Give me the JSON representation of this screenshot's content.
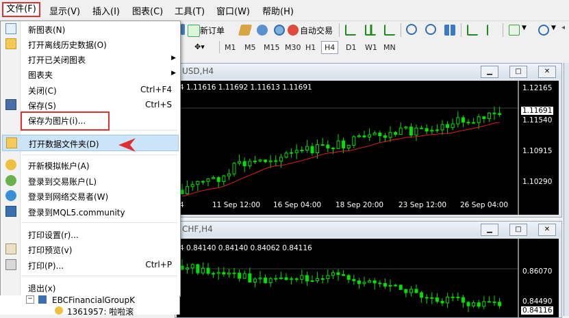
{
  "menubar": {
    "items": [
      "文件(F)",
      "显示(V)",
      "插入(I)",
      "图表(C)",
      "工具(T)",
      "窗口(W)",
      "帮助(H)"
    ]
  },
  "toolbar": {
    "new_order": "新订单",
    "auto_trading": "自动交易",
    "timeframes": [
      "M1",
      "M5",
      "M15",
      "M30",
      "H1",
      "H4",
      "D1",
      "W1",
      "MN"
    ],
    "active_timeframe": "H4"
  },
  "file_menu": {
    "items": [
      {
        "label": "新图表(N)",
        "shortcut": "",
        "submenu": false,
        "icon": "new-chart-icon"
      },
      {
        "label": "打开离线历史数据(O)",
        "shortcut": "",
        "submenu": false,
        "icon": "open-folder-icon"
      },
      {
        "label": "打开已关闭图表",
        "shortcut": "",
        "submenu": true,
        "icon": ""
      },
      {
        "label": "图表夹",
        "shortcut": "",
        "submenu": true,
        "icon": ""
      },
      {
        "label": "关闭(C)",
        "shortcut": "Ctrl+F4",
        "submenu": false,
        "icon": ""
      },
      {
        "label": "保存(S)",
        "shortcut": "Ctrl+S",
        "submenu": false,
        "icon": "save-icon"
      },
      {
        "label": "保存为图片(i)...",
        "shortcut": "",
        "submenu": false,
        "icon": ""
      },
      {
        "label": "打开数据文件夹(D)",
        "shortcut": "",
        "submenu": false,
        "icon": "data-folder-icon"
      },
      {
        "label": "开新模拟帐户(A)",
        "shortcut": "",
        "submenu": false,
        "icon": "demo-account-icon"
      },
      {
        "label": "登录到交易账户(L)",
        "shortcut": "",
        "submenu": false,
        "icon": "login-icon"
      },
      {
        "label": "登录到网络交易者(W)",
        "shortcut": "",
        "submenu": false,
        "icon": "web-trader-icon"
      },
      {
        "label": "登录到MQL5.community",
        "shortcut": "",
        "submenu": false,
        "icon": "mql5-icon"
      },
      {
        "label": "打印设置(r)...",
        "shortcut": "",
        "submenu": false,
        "icon": ""
      },
      {
        "label": "打印预览(v)",
        "shortcut": "",
        "submenu": false,
        "icon": "print-preview-icon"
      },
      {
        "label": "打印(P)...",
        "shortcut": "Ctrl+P",
        "submenu": false,
        "icon": "print-icon"
      },
      {
        "label": "退出(x)",
        "shortcut": "",
        "submenu": false,
        "icon": ""
      }
    ]
  },
  "chart1": {
    "title": "USD,H4",
    "ohlc": "4  1.11616  1.11692  1.11613  1.11691",
    "price_labels": [
      "1.12165",
      "1.11540",
      "1.10915",
      "1.10290"
    ],
    "current_price": "1.11691",
    "time_labels": [
      "4",
      "11 Sep 12:00",
      "16 Sep 04:00",
      "18 Sep 20:00",
      "23 Sep 12:00",
      "26 Sep 04:00"
    ]
  },
  "chart2": {
    "title": "CHF,H4",
    "ohlc": "4  0.84140  0.84140  0.84062  0.84116",
    "price_labels": [
      "0.86070",
      "0.84490"
    ],
    "current_price": "0.84116"
  },
  "navigator": {
    "broker": "EBCFinancialGroupK",
    "account": "1361957: 啦啦滚"
  },
  "colors": {
    "highlight_border": "#e03030",
    "bull_candle": "#00e000",
    "moving_average": "#e02020",
    "chart_bg": "#000000"
  }
}
